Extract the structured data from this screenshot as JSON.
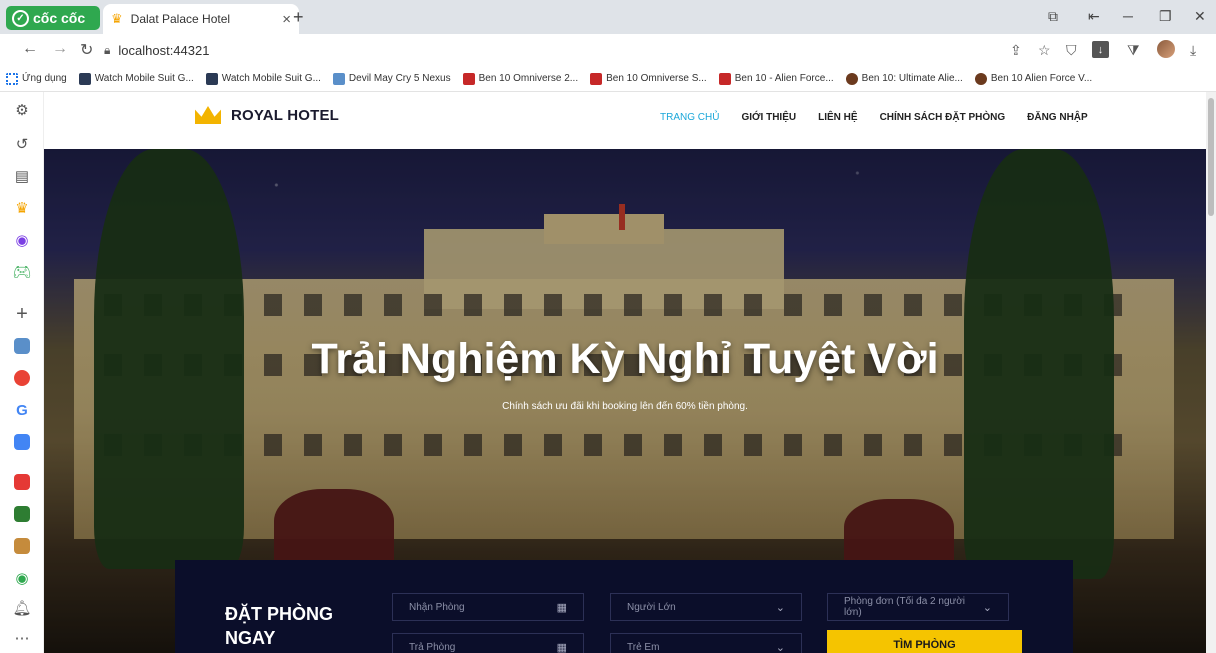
{
  "browser": {
    "brand_name": "cốc cốc",
    "tab_title": "Dalat Palace Hotel",
    "url": "localhost:44321",
    "bookmarks": [
      {
        "label": "Ứng dụng",
        "icon": "apps-grid-icon"
      },
      {
        "label": "Watch Mobile Suit G...",
        "icon": "gundam-icon"
      },
      {
        "label": "Watch Mobile Suit G...",
        "icon": "gundam-icon"
      },
      {
        "label": "Devil May Cry 5 Nexus",
        "icon": "nexus-icon"
      },
      {
        "label": "Ben 10 Omniverse 2...",
        "icon": "ben10-icon"
      },
      {
        "label": "Ben 10 Omniverse S...",
        "icon": "ben10-icon"
      },
      {
        "label": "Ben 10 - Alien Force...",
        "icon": "ben10-icon"
      },
      {
        "label": "Ben 10: Ultimate Alie...",
        "icon": "ben10-badge-icon"
      },
      {
        "label": "Ben 10 Alien Force V...",
        "icon": "ben10-badge-icon"
      }
    ]
  },
  "site": {
    "logo_text": "ROYAL HOTEL",
    "menu": [
      {
        "label": "TRANG CHỦ",
        "active": true
      },
      {
        "label": "GIỚI THIỆU",
        "active": false
      },
      {
        "label": "LIÊN HỆ",
        "active": false
      },
      {
        "label": "CHÍNH SÁCH ĐẶT PHÒNG",
        "active": false
      },
      {
        "label": "ĐĂNG NHẬP",
        "active": false
      }
    ],
    "hero_title": "Trải Nghiệm Kỳ Nghỉ Tuyệt Vời",
    "hero_subtitle": "Chính sách ưu đãi khi booking lên đến 60% tiền phòng.",
    "booking": {
      "title": "ĐẶT PHÒNG NGAY",
      "checkin_placeholder": "Nhận Phòng",
      "checkout_placeholder": "Trả Phòng",
      "adults_placeholder": "Người Lớn",
      "children_placeholder": "Trẻ Em",
      "room_type": "Phòng đơn (Tối đa 2 người lớn)",
      "search_label": "TÌM PHÒNG"
    }
  },
  "colors": {
    "accent_menu": "#1aa7d9",
    "brand_green": "#2fa84f",
    "booking_bg": "#0b0e2a",
    "button_yellow": "#f5c400",
    "crown_gold": "#f3b400"
  }
}
